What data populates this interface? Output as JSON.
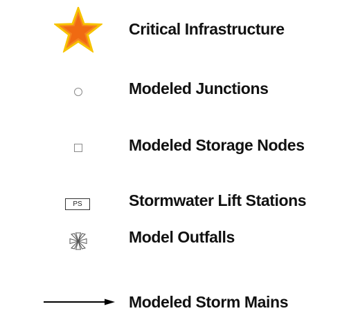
{
  "legend": {
    "items": [
      {
        "icon": "star-icon",
        "label": "Critical Infrastructure",
        "fill": "#f5821f",
        "stroke": "#f7c300"
      },
      {
        "icon": "circle-icon",
        "label": "Modeled Junctions"
      },
      {
        "icon": "square-icon",
        "label": "Modeled Storage Nodes"
      },
      {
        "icon": "lift-station-icon",
        "label": "Stormwater Lift Stations",
        "symbol_text": "PS"
      },
      {
        "icon": "outfall-icon",
        "label": "Model Outfalls"
      },
      {
        "icon": "arrow-icon",
        "label": "Modeled Storm Mains"
      }
    ]
  }
}
